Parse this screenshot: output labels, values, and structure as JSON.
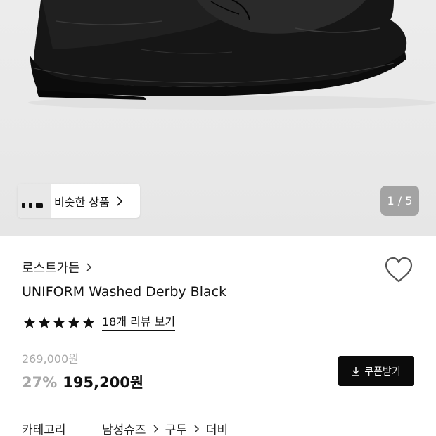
{
  "gallery": {
    "counter": "1 / 5",
    "similar_label": "비슷한 상품"
  },
  "product": {
    "brand": "로스트가든",
    "title": "UNIFORM Washed Derby Black",
    "rating_stars": 5,
    "review_link": "18개 리뷰 보기",
    "original_price": "269,000원",
    "discount": "27%",
    "sale_price": "195,200원",
    "coupon_label": "쿠폰받기"
  },
  "category": {
    "label": "카테고리",
    "crumbs": [
      "남성슈즈",
      "구두",
      "더비"
    ]
  },
  "icons": {
    "chevron": "chevron-right-icon",
    "heart": "heart-outline-icon",
    "star": "star-filled-icon",
    "download": "download-icon"
  },
  "colors": {
    "text": "#111111",
    "muted": "#aaaaaa",
    "button_bg": "#0b0b0b",
    "hero_bg": "#ebebeb"
  }
}
